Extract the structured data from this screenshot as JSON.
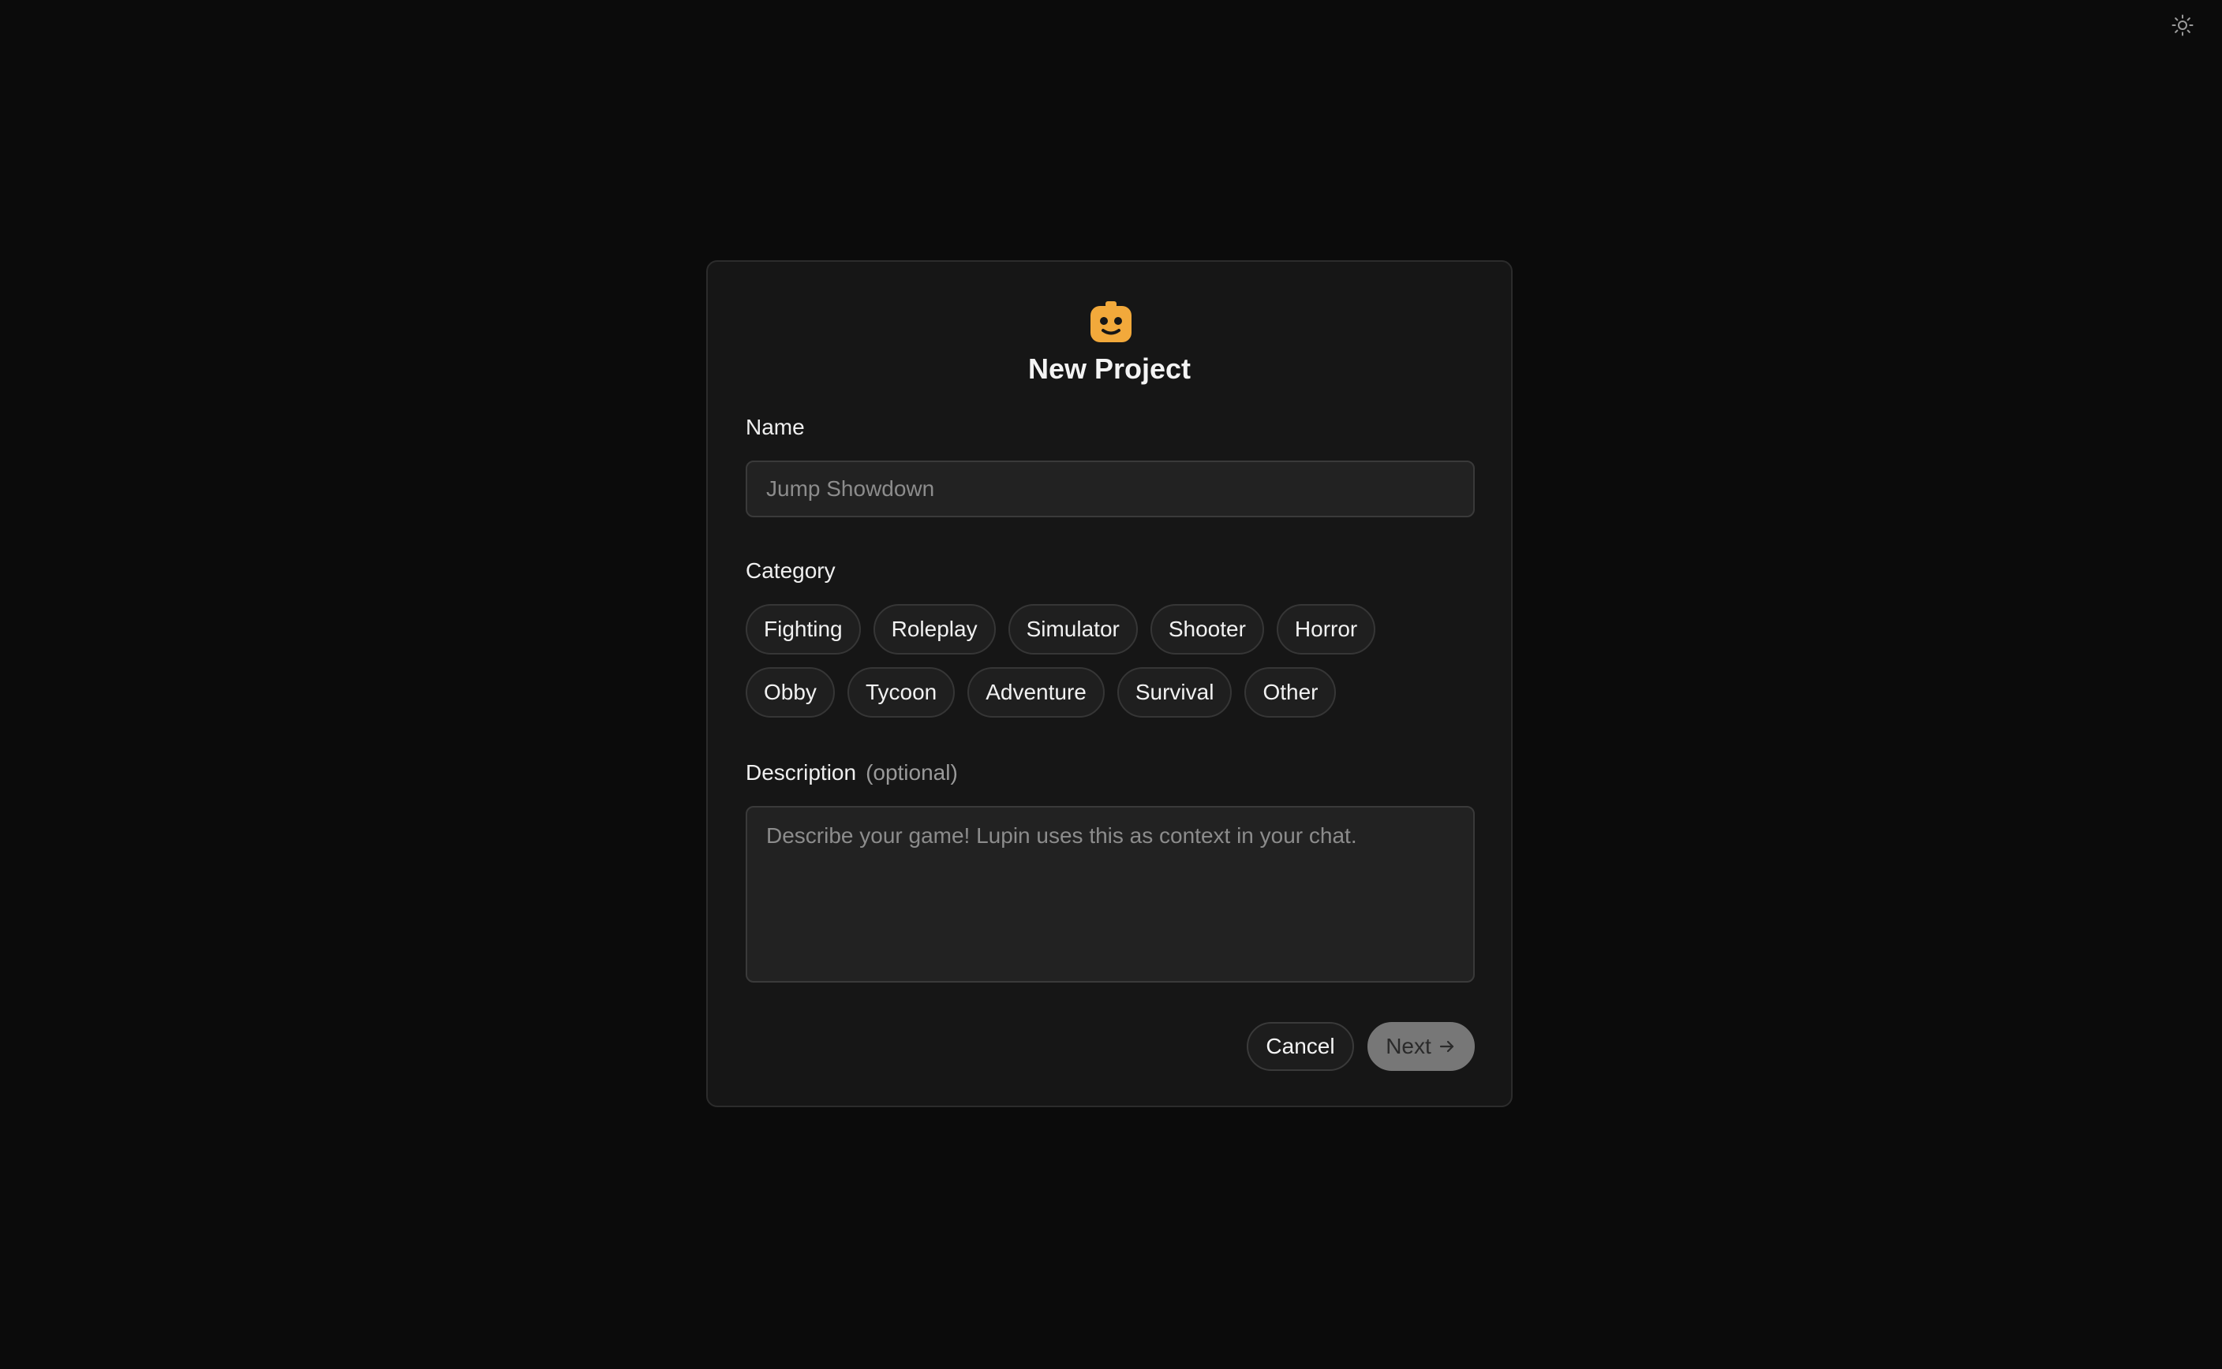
{
  "theme_toggle": {
    "icon": "sun-icon"
  },
  "modal": {
    "logo_icon": "lupin-face-icon",
    "title": "New Project",
    "name": {
      "label": "Name",
      "placeholder": "Jump Showdown",
      "value": ""
    },
    "category": {
      "label": "Category",
      "rows": [
        [
          "Fighting",
          "Roleplay",
          "Simulator",
          "Shooter",
          "Horror"
        ],
        [
          "Obby",
          "Tycoon",
          "Adventure",
          "Survival",
          "Other"
        ]
      ]
    },
    "description": {
      "label": "Description",
      "optional_label": "(optional)",
      "placeholder": "Describe your game! Lupin uses this as context in your chat.",
      "value": ""
    },
    "buttons": {
      "cancel": "Cancel",
      "next": "Next",
      "next_icon": "arrow-right-icon"
    }
  },
  "colors": {
    "background": "#0b0b0b",
    "panel": "#161616",
    "accent_logo": "#f2a93b",
    "next_button": "#777777"
  }
}
